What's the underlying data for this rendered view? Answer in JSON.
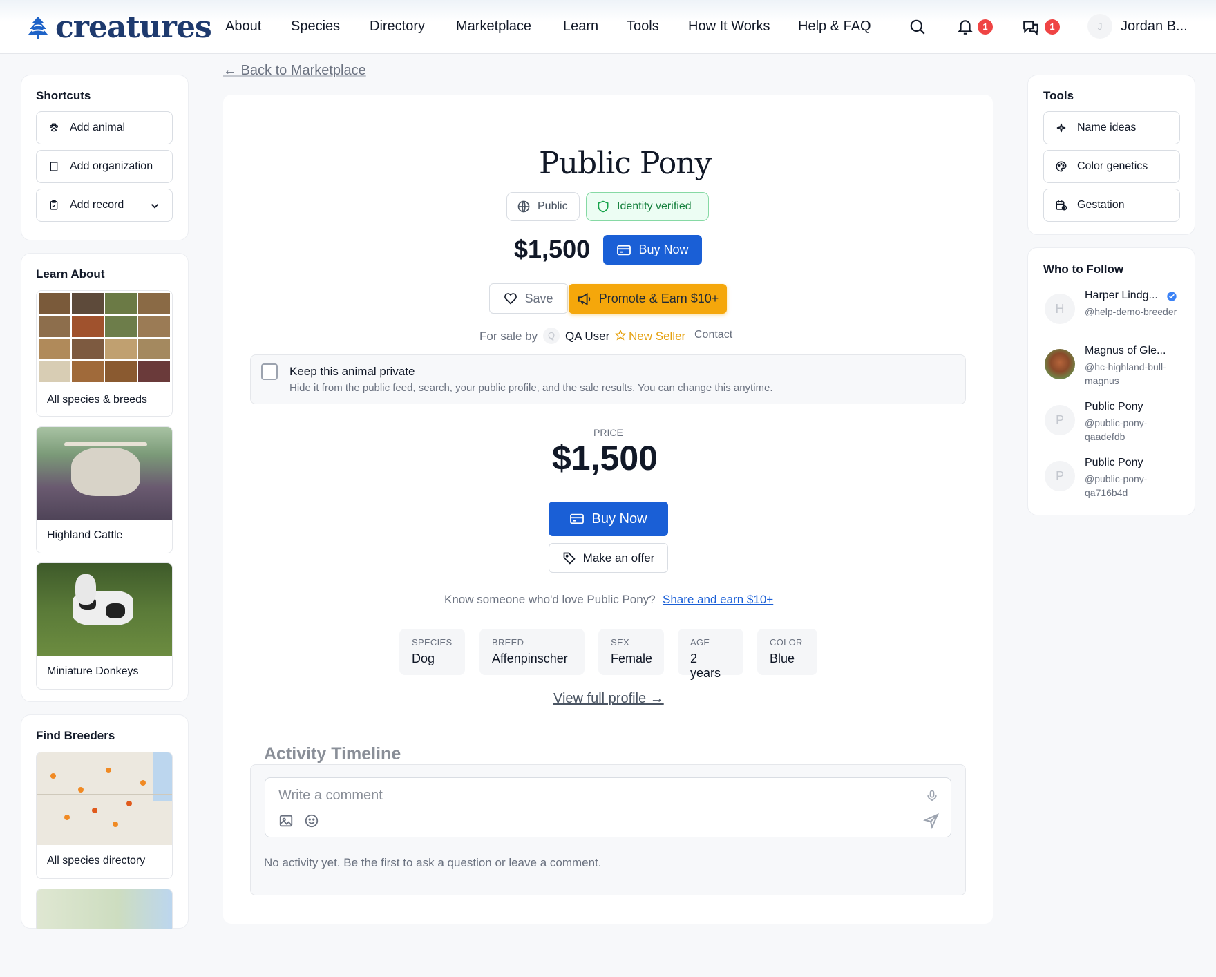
{
  "header": {
    "logo_text": "creatures",
    "nav": [
      "About",
      "Species",
      "Directory",
      "Marketplace",
      "Learn",
      "Tools",
      "How It Works",
      "Help & FAQ"
    ],
    "notifications_count": "1",
    "messages_count": "1",
    "user_initial": "J",
    "user_name": "Jordan B..."
  },
  "back_link": "← Back to Marketplace",
  "shortcuts": {
    "title": "Shortcuts",
    "items": [
      "Add animal",
      "Add organization",
      "Add record"
    ]
  },
  "learn_about": {
    "title": "Learn About",
    "items": [
      "All species & breeds",
      "Highland Cattle",
      "Miniature Donkeys"
    ]
  },
  "find_breeders": {
    "title": "Find Breeders",
    "items": [
      "All species directory"
    ]
  },
  "tools": {
    "title": "Tools",
    "items": [
      "Name ideas",
      "Color genetics",
      "Gestation"
    ]
  },
  "who_to_follow": {
    "title": "Who to Follow",
    "people": [
      {
        "initial": "H",
        "name": "Harper Lindg...",
        "handle": "@help-demo-breeder",
        "verified": true
      },
      {
        "initial": "",
        "name": "Magnus of Gle...",
        "handle": "@hc-highland-bull-magnus",
        "verified": false
      },
      {
        "initial": "P",
        "name": "Public Pony",
        "handle": "@public-pony-qaadefdb",
        "verified": false
      },
      {
        "initial": "P",
        "name": "Public Pony",
        "handle": "@public-pony-qa716b4d",
        "verified": false
      }
    ]
  },
  "listing": {
    "title": "Public Pony",
    "visibility": "Public",
    "verification": "Identity verified",
    "price": "$1,500",
    "buy_now": "Buy Now",
    "save": "Save",
    "promote": "Promote & Earn $10+",
    "for_sale_by": "For sale by",
    "seller_initial": "Q",
    "seller_name": "QA User",
    "seller_badge": "New Seller",
    "contact": "Contact",
    "private_title": "Keep this animal private",
    "private_desc": "Hide it from the public feed, search, your public profile, and the sale results. You can change this anytime.",
    "private_checked": false,
    "price_label": "PRICE",
    "make_offer": "Make an offer",
    "share_prompt": "Know someone who'd love Public Pony?",
    "share_link": "Share and earn $10+",
    "attributes": [
      {
        "key": "SPECIES",
        "value": "Dog"
      },
      {
        "key": "BREED",
        "value": "Affenpinscher"
      },
      {
        "key": "SEX",
        "value": "Female"
      },
      {
        "key": "AGE",
        "value": "2 years"
      },
      {
        "key": "COLOR",
        "value": "Blue"
      }
    ],
    "view_profile": "View full profile →"
  },
  "activity": {
    "title": "Activity Timeline",
    "comment_placeholder": "Write a comment",
    "empty": "No activity yet. Be the first to ask a question or leave a comment."
  },
  "colors": {
    "primary": "#1a5fd6",
    "promote": "#f5a70b",
    "verified_green": "#16a34a",
    "badge_red": "#ef4444",
    "new_seller": "#e5a00d"
  }
}
